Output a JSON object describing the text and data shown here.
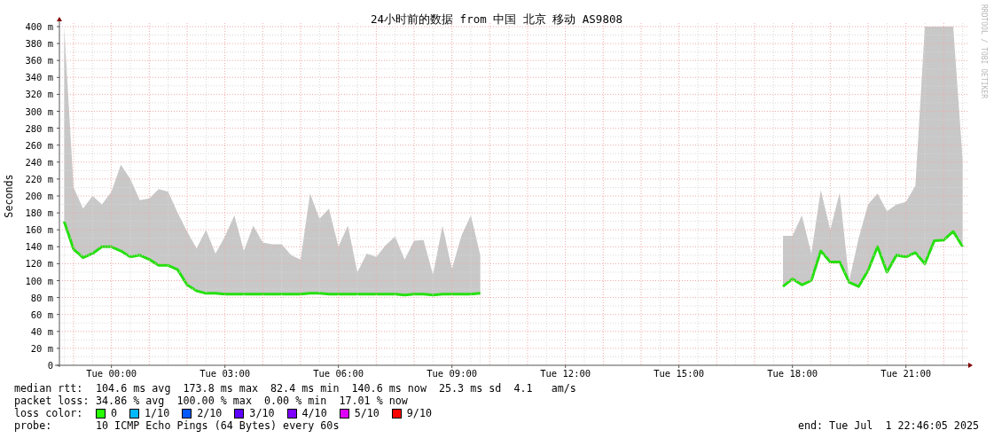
{
  "chart": {
    "credit": "RRDTOOL / TOBI OETIKER",
    "chart_data": {
      "type": "area",
      "grid": true,
      "title": "24小时前的数据 from 中国 北京 移动 AS9808",
      "ylabel": "Seconds",
      "ylim": [
        0,
        400
      ],
      "categories": [
        null,
        null,
        null,
        null,
        null,
        "Tue 00:00",
        null,
        null,
        null,
        null,
        null,
        null,
        null,
        null,
        null,
        null,
        null,
        "Tue 03:00",
        null,
        null,
        null,
        null,
        null,
        null,
        null,
        null,
        null,
        null,
        null,
        "Tue 06:00",
        null,
        null,
        null,
        null,
        null,
        null,
        null,
        null,
        null,
        null,
        null,
        "Tue 09:00",
        null,
        null,
        null,
        null,
        null,
        null,
        null,
        null,
        null,
        null,
        null,
        "Tue 12:00",
        null,
        null,
        null,
        null,
        null,
        null,
        null,
        null,
        null,
        null,
        null,
        "Tue 15:00",
        null,
        null,
        null,
        null,
        null,
        null,
        null,
        null,
        null,
        null,
        null,
        "Tue 18:00",
        null,
        null,
        null,
        null,
        null,
        null,
        null,
        null,
        null,
        null,
        null,
        "Tue 21:00",
        null,
        null,
        null,
        null,
        null,
        null
      ],
      "yticks": [
        {
          "value": 0,
          "label": "0"
        },
        {
          "value": 20,
          "label": "20 m"
        },
        {
          "value": 40,
          "label": "40 m"
        },
        {
          "value": 60,
          "label": "60 m"
        },
        {
          "value": 80,
          "label": "80 m"
        },
        {
          "value": 100,
          "label": "100 m"
        },
        {
          "value": 120,
          "label": "120 m"
        },
        {
          "value": 140,
          "label": "140 m"
        },
        {
          "value": 160,
          "label": "160 m"
        },
        {
          "value": 180,
          "label": "180 m"
        },
        {
          "value": 200,
          "label": "200 m"
        },
        {
          "value": 220,
          "label": "220 m"
        },
        {
          "value": 240,
          "label": "240 m"
        },
        {
          "value": 260,
          "label": "260 m"
        },
        {
          "value": 280,
          "label": "280 m"
        },
        {
          "value": 300,
          "label": "300 m"
        },
        {
          "value": 320,
          "label": "320 m"
        },
        {
          "value": 340,
          "label": "340 m"
        },
        {
          "value": 360,
          "label": "360 m"
        },
        {
          "value": 380,
          "label": "380 m"
        },
        {
          "value": 400,
          "label": "400 m"
        }
      ],
      "series": [
        {
          "color": "#c8c8c8",
          "values": [
            400,
            210,
            185,
            200,
            190,
            205,
            237,
            220,
            195,
            197,
            208,
            205,
            180,
            158,
            138,
            160,
            132,
            152,
            177,
            135,
            165,
            145,
            143,
            143,
            130,
            125,
            203,
            173,
            185,
            140,
            165,
            110,
            132,
            128,
            142,
            152,
            125,
            147,
            148,
            107,
            165,
            114,
            153,
            177,
            130,
            null,
            null,
            null,
            null,
            null,
            null,
            null,
            null,
            null,
            null,
            null,
            null,
            null,
            null,
            null,
            null,
            null,
            null,
            null,
            null,
            null,
            null,
            null,
            null,
            null,
            null,
            null,
            null,
            null,
            null,
            null,
            153,
            153,
            177,
            132,
            207,
            160,
            204,
            100,
            150,
            190,
            203,
            182,
            190,
            193,
            212,
            400,
            400,
            400,
            400,
            242
          ]
        },
        {
          "color": "#26e010",
          "values": [
            170,
            137,
            127,
            132,
            140,
            140,
            135,
            128,
            130,
            125,
            118,
            118,
            113,
            95,
            88,
            85,
            85,
            84,
            84,
            84,
            84,
            84,
            84,
            84,
            84,
            84,
            85,
            85,
            84,
            84,
            84,
            84,
            84,
            84,
            84,
            84,
            83,
            84,
            84,
            83,
            84,
            84,
            84,
            84,
            85,
            null,
            null,
            null,
            null,
            null,
            null,
            null,
            null,
            null,
            null,
            null,
            null,
            null,
            null,
            null,
            null,
            null,
            null,
            null,
            null,
            null,
            null,
            null,
            null,
            null,
            null,
            null,
            null,
            null,
            null,
            null,
            93,
            102,
            95,
            100,
            135,
            122,
            122,
            98,
            93,
            112,
            140,
            110,
            130,
            128,
            133,
            120,
            147,
            148,
            158,
            140
          ]
        }
      ]
    }
  },
  "stats": [
    {
      "label": "median rtt:",
      "text": "104.6 ms avg  173.8 ms max  82.4 ms min  140.6 ms now  25.3 ms sd  4.1   am/s"
    },
    {
      "label": "packet loss:",
      "text": "34.86 % avg  100.00 % max  0.00 % min  17.01 % now"
    }
  ],
  "loss_colors": {
    "label": "loss color:",
    "items": [
      {
        "label": "0",
        "color": "#26ff00"
      },
      {
        "label": "1/10",
        "color": "#00b8ff"
      },
      {
        "label": "2/10",
        "color": "#0059ff"
      },
      {
        "label": "3/10",
        "color": "#5e00ff"
      },
      {
        "label": "4/10",
        "color": "#7e00ff"
      },
      {
        "label": "5/10",
        "color": "#dd00ff"
      },
      {
        "label": "9/10",
        "color": "#ff0000"
      }
    ]
  },
  "probe": {
    "label": "probe:",
    "text": "10 ICMP Echo Pings (64 Bytes) every 60s"
  },
  "end": "end: Tue Jul  1 22:46:05 2025"
}
